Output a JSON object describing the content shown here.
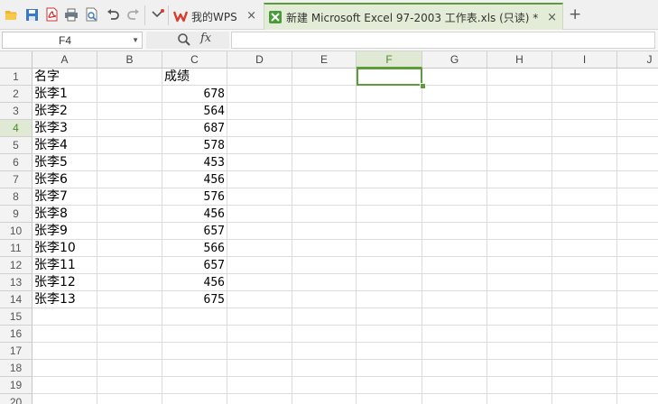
{
  "toolbar": {
    "icons": [
      "open-folder-icon",
      "save-icon",
      "export-pdf-icon",
      "print-icon",
      "print-preview-icon",
      "undo-icon",
      "redo-icon",
      "customize-icon"
    ]
  },
  "tabs": [
    {
      "label": "我的WPS",
      "close": "×",
      "active": false
    },
    {
      "label": "新建 Microsoft Excel 97-2003 工作表.xls (只读) *",
      "close": "×",
      "active": true
    }
  ],
  "new_tab": "+",
  "name_box": "F4",
  "fx_label": "fx",
  "formula_value": "",
  "columns": [
    "A",
    "B",
    "C",
    "D",
    "E",
    "F",
    "G",
    "H",
    "I",
    "J"
  ],
  "active_column": "F",
  "rows": [
    "1",
    "2",
    "3",
    "4",
    "5",
    "6",
    "7",
    "8",
    "9",
    "10",
    "11",
    "12",
    "13",
    "14",
    "15",
    "16",
    "17",
    "18",
    "19",
    "20"
  ],
  "active_row": "4",
  "header_row": {
    "A": "名字",
    "C": "成绩"
  },
  "data": [
    {
      "name": "张李1",
      "score": "678"
    },
    {
      "name": "张李2",
      "score": "564"
    },
    {
      "name": "张李3",
      "score": "687"
    },
    {
      "name": "张李4",
      "score": "578"
    },
    {
      "name": "张李5",
      "score": "453"
    },
    {
      "name": "张李6",
      "score": "456"
    },
    {
      "name": "张李7",
      "score": "576"
    },
    {
      "name": "张李8",
      "score": "456"
    },
    {
      "name": "张李9",
      "score": "657"
    },
    {
      "name": "张李10",
      "score": "566"
    },
    {
      "name": "张李11",
      "score": "657"
    },
    {
      "name": "张李12",
      "score": "456"
    },
    {
      "name": "张李13",
      "score": "675"
    }
  ],
  "colors": {
    "accent": "#5d9c3a",
    "wps_red": "#d83b2c"
  }
}
